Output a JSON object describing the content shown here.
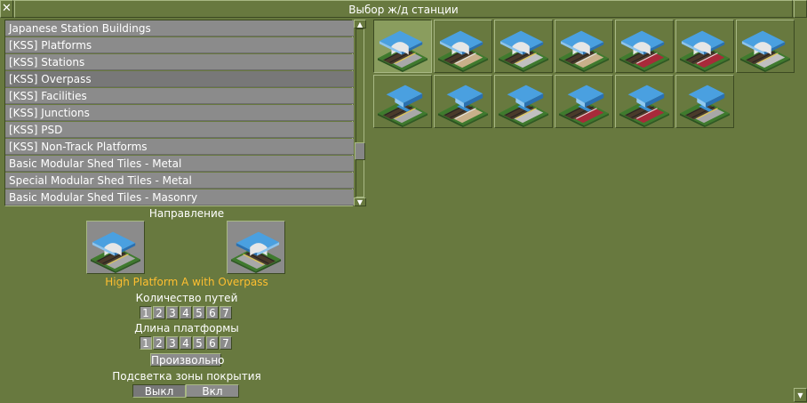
{
  "window": {
    "title": "Выбор ж/д станции",
    "close_glyph": "✕"
  },
  "station_classes": {
    "selected_index": 3,
    "items": [
      "Japanese Station Buildings",
      "[KSS] Platforms",
      "[KSS] Stations",
      "[KSS] Overpass",
      "[KSS] Facilities",
      "[KSS] Junctions",
      "[KSS] PSD",
      "[KSS] Non-Track Platforms",
      "Basic Modular Shed Tiles - Metal",
      "Special Modular Shed Tiles - Metal",
      "Basic Modular Shed Tiles - Masonry"
    ]
  },
  "scrollbar": {
    "up_glyph": "▲",
    "down_glyph": "▼"
  },
  "station_grid": {
    "selected_index": 0,
    "tiles": [
      {
        "icon": "overpass-platform-icon",
        "platform_color": "#a8a8a8",
        "stripe": "#e8c840"
      },
      {
        "icon": "overpass-platform-icon",
        "platform_color": "#c8b08a",
        "stripe": "#e8e8e8"
      },
      {
        "icon": "overpass-platform-icon",
        "platform_color": "#c0c0c0",
        "stripe": "#e8c840"
      },
      {
        "icon": "overpass-platform-icon",
        "platform_color": "#c8b08a",
        "stripe": "#e8e8e8"
      },
      {
        "icon": "overpass-platform-icon",
        "platform_color": "#a82a3a",
        "stripe": "#e8e8e8"
      },
      {
        "icon": "overpass-platform-icon",
        "platform_color": "#a82a3a",
        "stripe": "#e8e8e8"
      },
      {
        "icon": "overpass-platform-icon",
        "platform_color": "#c0c0c0",
        "stripe": "#e8c840"
      },
      {
        "icon": "overpass-ramp-icon",
        "platform_color": "#a8a8a8",
        "stripe": "#e8c840"
      },
      {
        "icon": "overpass-ramp-icon",
        "platform_color": "#c8b08a",
        "stripe": "#e8e8e8"
      },
      {
        "icon": "overpass-ramp-icon",
        "platform_color": "#c0c0c0",
        "stripe": "#e8c840"
      },
      {
        "icon": "overpass-ramp-icon",
        "platform_color": "#a82a3a",
        "stripe": "#e8e8e8"
      },
      {
        "icon": "overpass-ramp-icon",
        "platform_color": "#a82a3a",
        "stripe": "#e8e8e8"
      },
      {
        "icon": "overpass-ramp-icon",
        "platform_color": "#a8a8a8",
        "stripe": "#e8c840"
      }
    ]
  },
  "orientation": {
    "label": "Направление"
  },
  "station_name": "High Platform A with Overpass",
  "tracks": {
    "label": "Количество путей",
    "options": [
      "1",
      "2",
      "3",
      "4",
      "5",
      "6",
      "7"
    ],
    "selected": "1"
  },
  "platform_length": {
    "label": "Длина платформы",
    "options": [
      "1",
      "2",
      "3",
      "4",
      "5",
      "6",
      "7"
    ],
    "selected": "1"
  },
  "drag_drop_button": "Произвольно",
  "coverage": {
    "label": "Подсветка зоны покрытия",
    "off": "Выкл",
    "on": "Вкл",
    "active": "off"
  },
  "colors": {
    "window_bg": "#68793f",
    "list_bg": "#8b8b8b",
    "highlight_text": "#ffbf30"
  }
}
